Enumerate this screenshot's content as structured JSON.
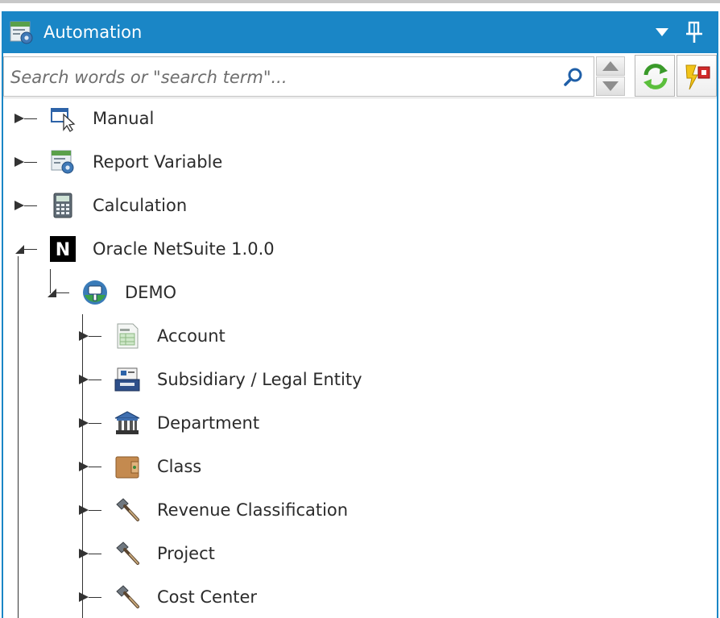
{
  "panel": {
    "title": "Automation",
    "title_icon": "report-gear-icon",
    "controls": [
      {
        "name": "dropdown-arrow",
        "icon": "triangle-down-icon"
      },
      {
        "name": "pin",
        "icon": "pin-icon"
      }
    ]
  },
  "search": {
    "placeholder": "Search words or \"search term\"...",
    "value": "",
    "icon": "magnifier-icon"
  },
  "toolbar": {
    "spinner_up_icon": "arrow-up-icon",
    "spinner_down_icon": "arrow-down-icon",
    "refresh_icon": "refresh-icon",
    "filter_icon": "filter-lightning-icon"
  },
  "tree": {
    "items": [
      {
        "label": "Manual",
        "icon": "cursor-window-icon",
        "expanded": false,
        "level": 0
      },
      {
        "label": "Report Variable",
        "icon": "report-gear-icon",
        "expanded": false,
        "level": 0
      },
      {
        "label": "Calculation",
        "icon": "calculator-icon",
        "expanded": false,
        "level": 0
      },
      {
        "label": "Oracle NetSuite 1.0.0",
        "icon": "netsuite-n-icon",
        "expanded": true,
        "level": 0
      },
      {
        "label": "DEMO",
        "icon": "database-connection-icon",
        "expanded": true,
        "level": 1
      },
      {
        "label": "Account",
        "icon": "ledger-sheet-icon",
        "expanded": false,
        "level": 2
      },
      {
        "label": "Subsidiary / Legal Entity",
        "icon": "printer-register-icon",
        "expanded": false,
        "level": 2
      },
      {
        "label": "Department",
        "icon": "bank-building-icon",
        "expanded": false,
        "level": 2
      },
      {
        "label": "Class",
        "icon": "wallet-icon",
        "expanded": false,
        "level": 2
      },
      {
        "label": "Revenue Classification",
        "icon": "hammer-icon",
        "expanded": false,
        "level": 2
      },
      {
        "label": "Project",
        "icon": "hammer-icon",
        "expanded": false,
        "level": 2
      },
      {
        "label": "Cost Center",
        "icon": "hammer-icon",
        "expanded": false,
        "level": 2
      }
    ]
  },
  "colors": {
    "title_bar": "#1a86c6",
    "text": "#2b2b2b"
  }
}
